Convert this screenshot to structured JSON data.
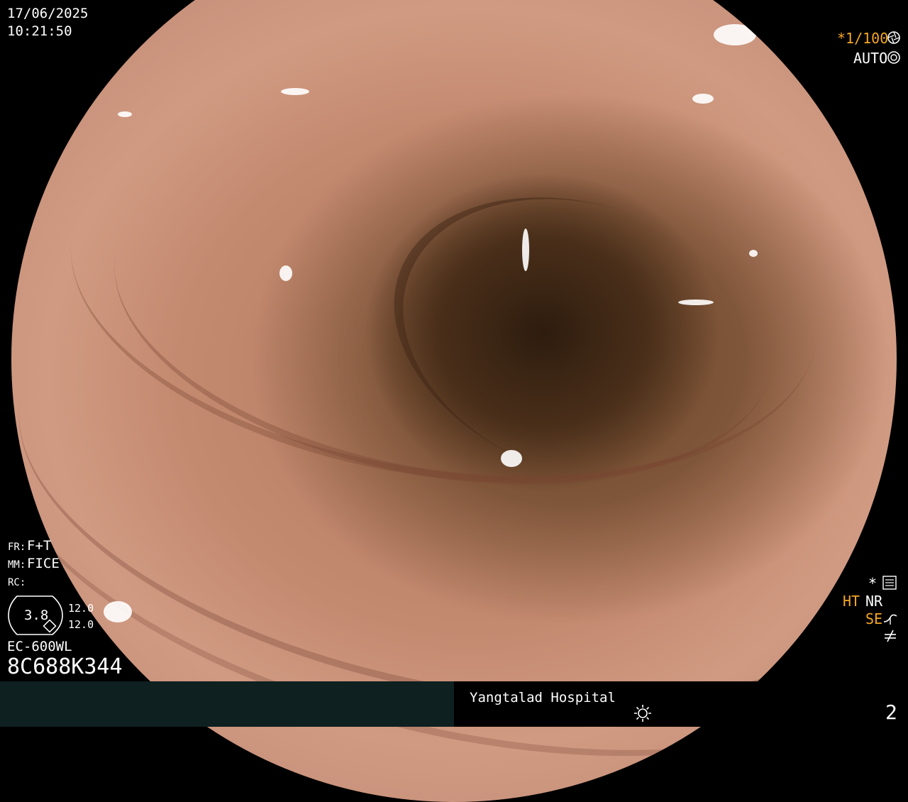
{
  "datetime": {
    "date": "17/06/2025",
    "time": "10:21:50"
  },
  "shutter": {
    "value": "*1/100",
    "icon": "shutter-icon"
  },
  "iris": {
    "mode": "AUTO",
    "icon": "iris-icon"
  },
  "settings": {
    "fr_label": "FR:",
    "fr_value": "F+T",
    "mm_label": "MM:",
    "mm_value": "FICE",
    "rc_label": "RC:"
  },
  "zoom": {
    "value": "3.8",
    "upper": "12.0",
    "lower": "12.0"
  },
  "scope_model": "EC-600WL",
  "serial": "8C688K344",
  "right_panel": {
    "star": "*",
    "ht": "HT",
    "nr": "NR",
    "se": "SE",
    "icons": [
      "menu-settings-icon",
      "curve-icon",
      "not-equal-icon"
    ]
  },
  "footer": {
    "hospital": "Yangtalad Hospital",
    "light_icon": "light-icon",
    "image_number": "2"
  },
  "colors": {
    "accent_orange": "#f5a623",
    "footer_left": "#0f2020",
    "footer_right": "#000000"
  }
}
